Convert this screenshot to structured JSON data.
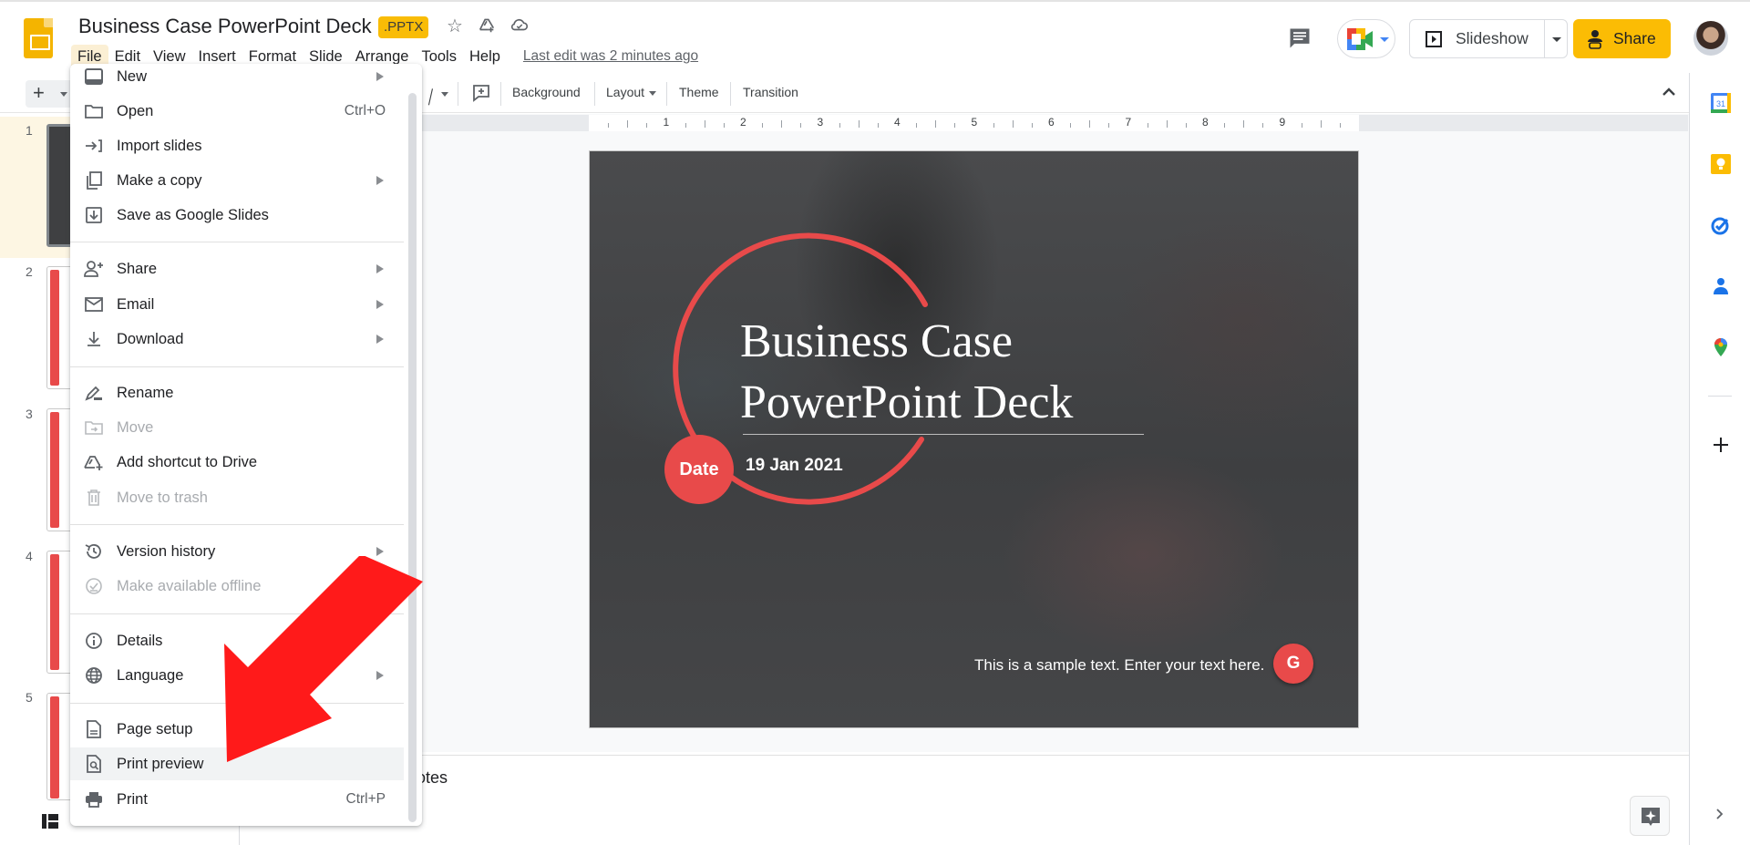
{
  "header": {
    "doc_title": "Business Case  PowerPoint Deck",
    "file_badge": ".PPTX",
    "menus": [
      "File",
      "Edit",
      "View",
      "Insert",
      "Format",
      "Slide",
      "Arrange",
      "Tools",
      "Help"
    ],
    "active_menu": "File",
    "last_edit": "Last edit was 2 minutes ago",
    "slideshow_label": "Slideshow",
    "share_label": "Share",
    "share_color": "#fbbc04"
  },
  "toolbar": {
    "background_label": "Background",
    "layout_label": "Layout",
    "theme_label": "Theme",
    "transition_label": "Transition"
  },
  "ruler": {
    "numbers": [
      "1",
      "2",
      "3",
      "4",
      "5",
      "6",
      "7",
      "8",
      "9"
    ]
  },
  "filmstrip": {
    "slides": [
      "1",
      "2",
      "3",
      "4",
      "5"
    ],
    "selected": "1"
  },
  "slide": {
    "title_line1": "Business Case",
    "title_line2": "PowerPoint Deck",
    "date_badge": "Date",
    "date_text": "19 Jan 2021",
    "sample_text": "This is a sample text. Enter your text here.",
    "logo_letter": "G",
    "accent_color": "#e84a4a"
  },
  "notes": {
    "placeholder_visible": "otes"
  },
  "file_menu": {
    "items": [
      {
        "label": "New",
        "icon": "new-doc-icon",
        "submenu": true
      },
      {
        "label": "Open",
        "icon": "folder-icon",
        "shortcut": "Ctrl+O"
      },
      {
        "label": "Import slides",
        "icon": "import-icon"
      },
      {
        "label": "Make a copy",
        "icon": "copy-icon",
        "submenu": true
      },
      {
        "label": "Save as Google Slides",
        "icon": "save-icon"
      },
      {
        "label": "Share",
        "icon": "person-add-icon",
        "submenu": true
      },
      {
        "label": "Email",
        "icon": "email-icon",
        "submenu": true
      },
      {
        "label": "Download",
        "icon": "download-icon",
        "submenu": true
      },
      {
        "label": "Rename",
        "icon": "rename-icon"
      },
      {
        "label": "Move",
        "icon": "move-icon",
        "disabled": true
      },
      {
        "label": "Add shortcut to Drive",
        "icon": "drive-shortcut-icon"
      },
      {
        "label": "Move to trash",
        "icon": "trash-icon",
        "disabled": true
      },
      {
        "label": "Version history",
        "icon": "history-icon",
        "submenu": true
      },
      {
        "label": "Make available offline",
        "icon": "offline-icon",
        "disabled": true
      },
      {
        "label": "Details",
        "icon": "info-icon"
      },
      {
        "label": "Language",
        "icon": "globe-icon",
        "submenu": true
      },
      {
        "label": "Page setup",
        "icon": "page-icon"
      },
      {
        "label": "Print preview",
        "icon": "print-preview-icon",
        "highlighted": true
      },
      {
        "label": "Print",
        "icon": "print-icon",
        "shortcut": "Ctrl+P"
      }
    ]
  },
  "annotation": {
    "arrow_color": "#ff1a1a",
    "points_to": "Print preview"
  },
  "right_sidebar": {
    "apps": [
      "calendar-icon",
      "keep-icon",
      "tasks-icon",
      "contacts-icon",
      "maps-icon",
      "add-icon"
    ],
    "calendar_day": "31"
  }
}
